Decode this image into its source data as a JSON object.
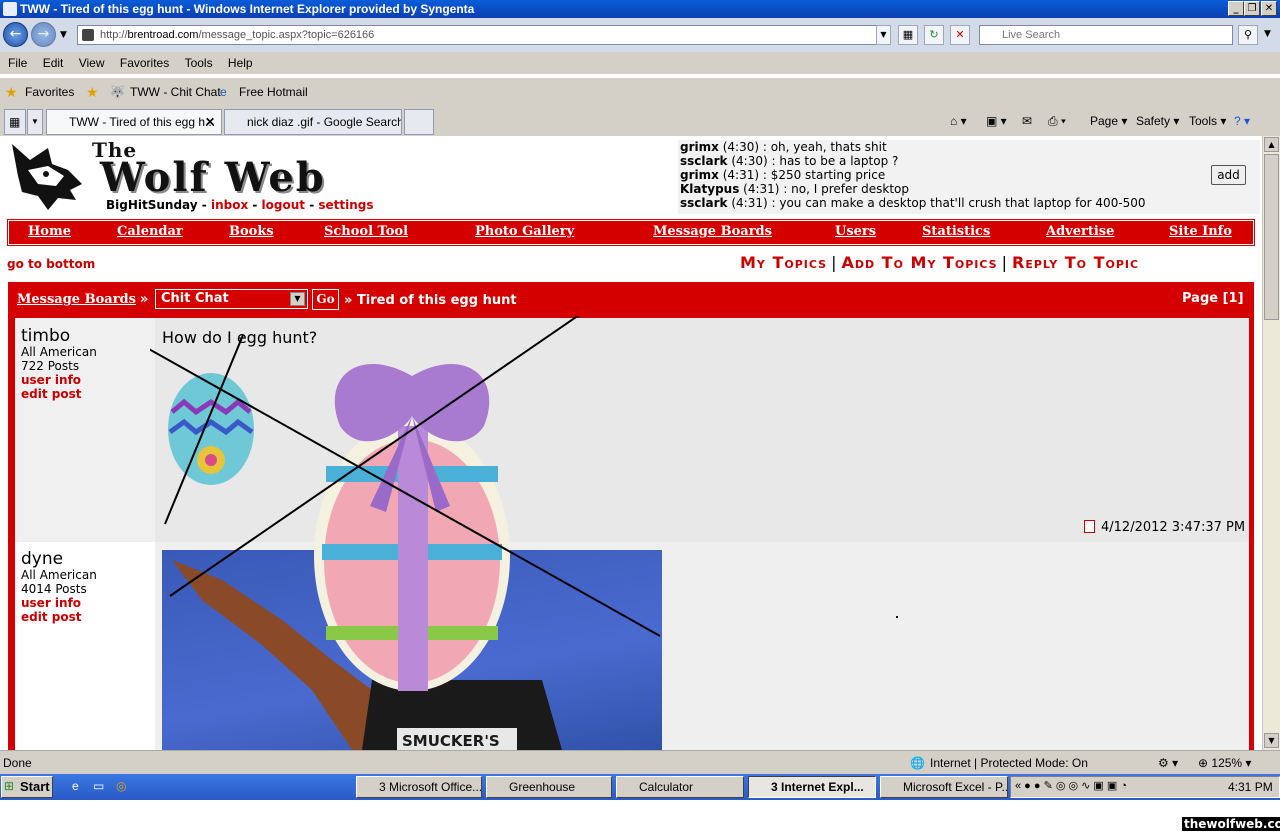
{
  "window": {
    "title": "TWW - Tired of this egg hunt - Windows Internet Explorer provided by Syngenta"
  },
  "address": {
    "url_prefix": "http://",
    "host": "brentroad.com",
    "path": "/message_topic.aspx?topic=626166",
    "search_placeholder": "Live Search"
  },
  "menu": [
    "File",
    "Edit",
    "View",
    "Favorites",
    "Tools",
    "Help"
  ],
  "favorites": {
    "label": "Favorites",
    "items": [
      "TWW - Chit Chat",
      "Free Hotmail"
    ]
  },
  "tabs": [
    {
      "label": "TWW - Tired of this egg h...",
      "active": true
    },
    {
      "label": "nick diaz .gif - Google Search",
      "active": false
    }
  ],
  "commandbar": {
    "page": "Page",
    "safety": "Safety",
    "tools": "Tools"
  },
  "site": {
    "logo_the": "The",
    "logo_name": "Wolf Web",
    "user": "BigHitSunday",
    "inbox": "inbox",
    "logout": "logout",
    "settings": "settings",
    "shouts": [
      {
        "user": "grimx",
        "time": "(4:30)",
        "msg": ": oh, yeah, thats shit"
      },
      {
        "user": "ssclark",
        "time": "(4:30)",
        "msg": ": has to be a laptop ?"
      },
      {
        "user": "grimx",
        "time": "(4:31)",
        "msg": ": $250 starting price"
      },
      {
        "user": "Klatypus",
        "time": "(4:31)",
        "msg": ": no, I prefer desktop"
      },
      {
        "user": "ssclark",
        "time": "(4:31)",
        "msg": ": you can make a desktop that'll crush that laptop for 400-500"
      }
    ],
    "add": "add",
    "nav": [
      "Home",
      "Calendar",
      "Books",
      "School Tool",
      "Photo Gallery",
      "Message Boards",
      "Users",
      "Statistics",
      "Advertise",
      "Site Info"
    ],
    "go_to_bottom": "go to bottom",
    "top_links": [
      "My Topics",
      "Add To My Topics",
      "Reply To Topic"
    ],
    "crumb": "Message Boards",
    "crumb_sep": "»",
    "forum": "Chit Chat",
    "go": "Go",
    "topic": "» Tired of this egg hunt",
    "page": "Page [1]"
  },
  "posts": [
    {
      "user": "timbo",
      "rank": "All American",
      "posts": "722 Posts",
      "user_info": "user info",
      "edit": "edit post",
      "text": "How do I egg hunt?",
      "time": "4/12/2012 3:47:37 PM"
    },
    {
      "user": "dyne",
      "rank": "All American",
      "posts": "4014 Posts",
      "user_info": "user info",
      "edit": "edit post",
      "photo_text": "SMUCKER'S"
    }
  ],
  "status": {
    "left": "Done",
    "zone": "Internet | Protected Mode: On",
    "zoom": "125%"
  },
  "taskbar": {
    "start": "Start",
    "tasks": [
      "3 Microsoft Office...",
      "Greenhouse",
      "Calculator",
      "3 Internet Expl...",
      "Microsoft Excel - P..."
    ],
    "clock": "4:31 PM"
  },
  "watermark": "thewolfweb.com",
  "colors": {
    "brand_red": "#d40000",
    "link_red": "#cc0000"
  }
}
